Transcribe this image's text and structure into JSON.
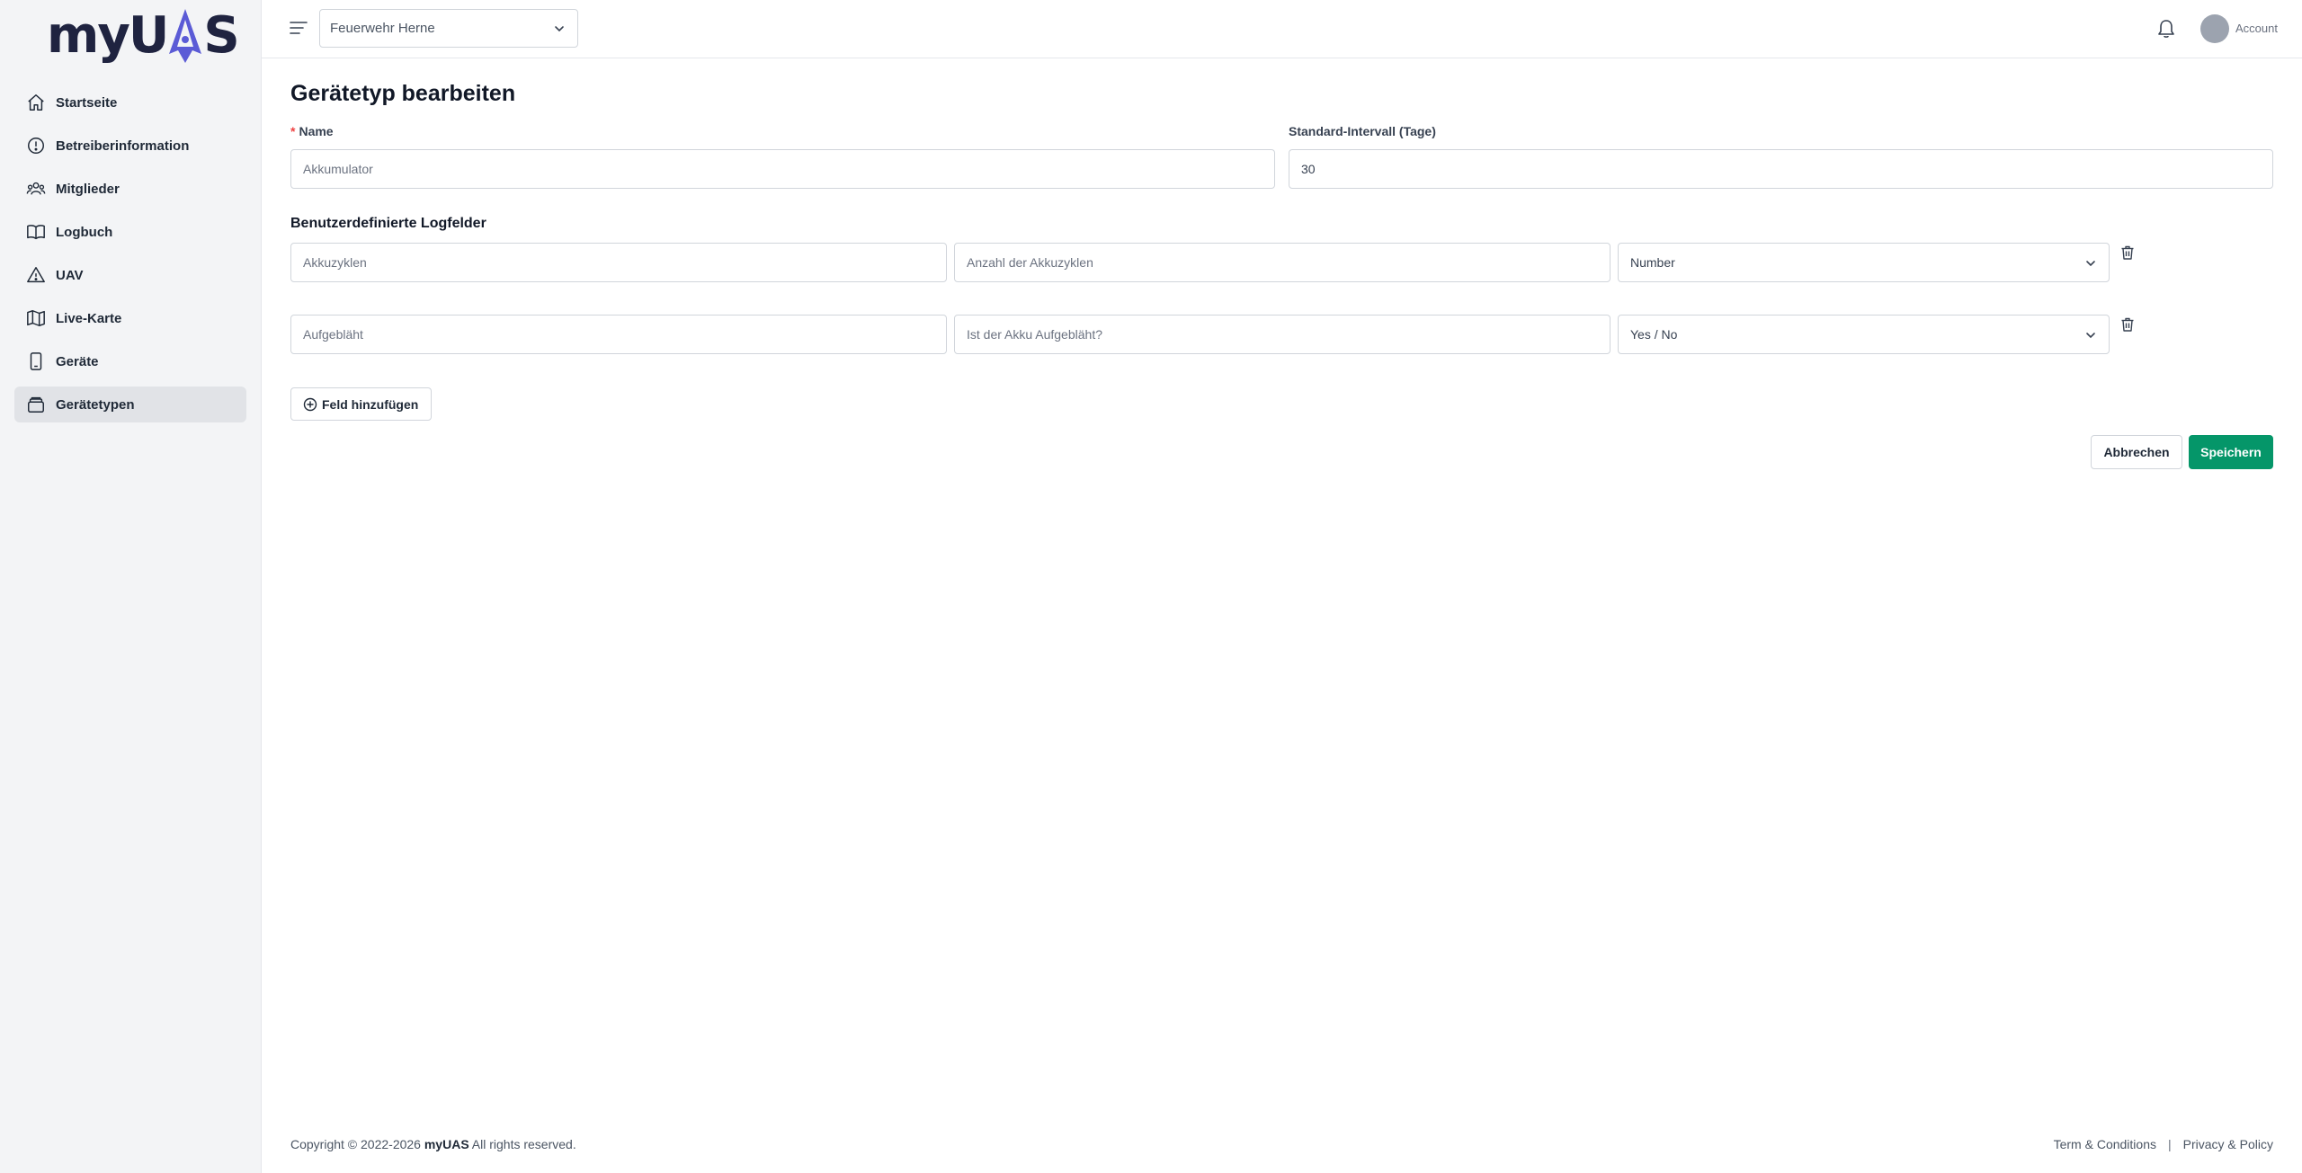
{
  "brand": {
    "logo_text_left": "myU",
    "logo_text_right": "S",
    "logo_icon": "rocket-a-icon",
    "accent": "#5b5bd6"
  },
  "sidebar": {
    "items": [
      {
        "label": "Startseite",
        "icon": "home-icon",
        "active": false
      },
      {
        "label": "Betreiberinformation",
        "icon": "info-circle-icon",
        "active": false
      },
      {
        "label": "Mitglieder",
        "icon": "users-icon",
        "active": false
      },
      {
        "label": "Logbuch",
        "icon": "book-icon",
        "active": false
      },
      {
        "label": "UAV",
        "icon": "triangle-icon",
        "active": false
      },
      {
        "label": "Live-Karte",
        "icon": "map-icon",
        "active": false
      },
      {
        "label": "Geräte",
        "icon": "device-icon",
        "active": false
      },
      {
        "label": "Gerätetypen",
        "icon": "stack-icon",
        "active": true
      }
    ]
  },
  "header": {
    "organization": "Feuerwehr Herne",
    "account_label": "Account"
  },
  "form": {
    "title": "Gerätetyp bearbeiten",
    "name_label": "Name",
    "name_required_mark": "*",
    "name_placeholder": "Akkumulator",
    "interval_label": "Standard-Intervall (Tage)",
    "interval_value": "30",
    "custom_fields_title": "Benutzerdefinierte Logfelder",
    "fields": [
      {
        "key": "Akkuzyklen",
        "label": "Anzahl der Akkuzyklen",
        "type": "Number"
      },
      {
        "key": "Aufgebläht",
        "label": "Ist der Akku Aufgebläht?",
        "type": "Yes / No"
      }
    ],
    "add_field_label": "Feld hinzufügen",
    "cancel_label": "Abbrechen",
    "save_label": "Speichern",
    "save_color": "#059669"
  },
  "footer": {
    "copyright_prefix": "Copyright © 2022-2026",
    "copyright_brand": "myUAS",
    "copyright_suffix": "All rights reserved.",
    "terms": "Term & Conditions",
    "separator": "|",
    "privacy": "Privacy & Policy"
  }
}
